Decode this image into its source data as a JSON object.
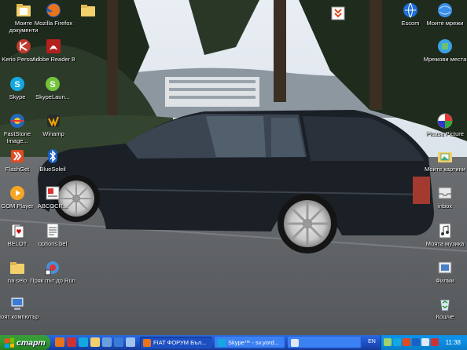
{
  "desktop_icons": [
    {
      "id": "my-documents",
      "label": "Моите документи",
      "icon": "documents-folder-icon"
    },
    {
      "id": "firefox",
      "label": "Mozilla Firefox",
      "icon": "firefox-icon"
    },
    {
      "id": "folder-top",
      "label": "",
      "icon": "folder-icon"
    },
    {
      "id": "kerio",
      "label": "Kerio Personal...",
      "icon": "kerio-icon"
    },
    {
      "id": "adobe-reader",
      "label": "Adobe Reader 8",
      "icon": "adobe-reader-icon"
    },
    {
      "id": "skype",
      "label": "Skype",
      "icon": "skype-icon"
    },
    {
      "id": "skypelauncher",
      "label": "SkypeLaun...",
      "icon": "skype-launcher-icon"
    },
    {
      "id": "faststone",
      "label": "FastStone Image...",
      "icon": "faststone-icon"
    },
    {
      "id": "winamp",
      "label": "Winamp",
      "icon": "winamp-icon"
    },
    {
      "id": "flashget",
      "label": "FlashGet",
      "icon": "flashget-icon"
    },
    {
      "id": "bluesoleil",
      "label": "BlueSoleil",
      "icon": "bluetooth-icon"
    },
    {
      "id": "gomplayer",
      "label": "GOM Player",
      "icon": "gom-player-icon"
    },
    {
      "id": "abcocr",
      "label": "ABCOCR...",
      "icon": "abc-ocr-icon"
    },
    {
      "id": "belot",
      "label": "BELOT",
      "icon": "cards-icon"
    },
    {
      "id": "options-bel",
      "label": "options.bel",
      "icon": "text-file-icon"
    },
    {
      "id": "na-selo",
      "label": "na selo",
      "icon": "folder-icon"
    },
    {
      "id": "run-shortcut",
      "label": "Пряк път до Run",
      "icon": "shortcut-icon"
    },
    {
      "id": "my-computer",
      "label": "Моят компютър",
      "icon": "my-computer-icon"
    },
    {
      "id": "download-top",
      "label": "",
      "icon": "download-icon"
    },
    {
      "id": "escom",
      "label": "Escom",
      "icon": "escom-icon"
    },
    {
      "id": "network",
      "label": "Моите мрежи",
      "icon": "network-icon"
    },
    {
      "id": "network2",
      "label": "Мрежови места",
      "icon": "network-places-icon"
    },
    {
      "id": "picasa",
      "label": "Picasa Picture",
      "icon": "picasa-icon"
    },
    {
      "id": "my-pictures",
      "label": "Моите картини",
      "icon": "pictures-icon"
    },
    {
      "id": "inbox",
      "label": "inbox",
      "icon": "inbox-icon"
    },
    {
      "id": "my-music",
      "label": "Моята музика",
      "icon": "music-icon"
    },
    {
      "id": "films",
      "label": "Филми",
      "icon": "video-icon"
    },
    {
      "id": "recycle-bin",
      "label": "Кошче",
      "icon": "recycle-bin-icon"
    }
  ],
  "taskbar": {
    "start_label": "старт",
    "tasks": [
      {
        "label": "FIAT ФОРУМ Бъл...",
        "state": "active",
        "icon": "firefox-icon"
      },
      {
        "label": "Skype™ - sv.yord...",
        "state": "inactive",
        "icon": "skype-icon"
      },
      {
        "label": "",
        "state": "inactive",
        "icon": "window-icon"
      }
    ],
    "language": "EN",
    "clock": "11:38"
  },
  "colors": {
    "taskbar": "#245edb",
    "start": "#319e31",
    "tray": "#0c93ec"
  }
}
